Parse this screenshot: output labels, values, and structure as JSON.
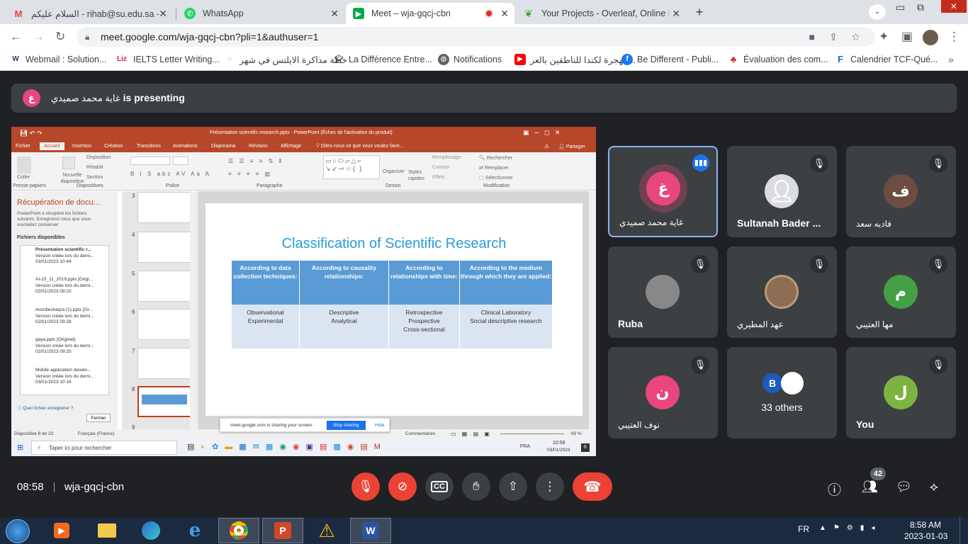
{
  "browser": {
    "tabs": [
      {
        "title": "السلام عليكم - rihab@su.edu.sa - جامعة",
        "icon": "gmail-icon"
      },
      {
        "title": "WhatsApp",
        "icon": "whatsapp-icon"
      },
      {
        "title": "Meet – wja-gqcj-cbn",
        "icon": "meet-icon",
        "active": true
      },
      {
        "title": "Your Projects - Overleaf, Online L",
        "icon": "overleaf-icon"
      }
    ],
    "url": "meet.google.com/wja-gqcj-cbn?pli=1&authuser=1",
    "bookmarks": [
      {
        "label": "Webmail : Solution...",
        "icon": "webmail-icon"
      },
      {
        "label": "IELTS Letter Writing...",
        "icon": "liz-icon",
        "badge": "Liz"
      },
      {
        "label": "خطة مذاكرة الايلتس في شهر",
        "icon": "loading-icon"
      },
      {
        "label": "La Différence Entre...",
        "icon": "graduation-icon"
      },
      {
        "label": "Notifications",
        "icon": "globe-icon"
      },
      {
        "label": "الهجرة لكندا للناطقين بالعر...",
        "icon": "youtube-icon"
      },
      {
        "label": "Be Different - Publi...",
        "icon": "facebook-icon"
      },
      {
        "label": "Évaluation des com...",
        "icon": "maple-icon"
      },
      {
        "label": "Calendrier TCF-Qué...",
        "icon": "f-icon"
      }
    ]
  },
  "meet": {
    "presenter_initial": "غ",
    "presenter_name": "غاية محمد صميدي",
    "presenting_suffix": "is presenting",
    "time": "08:58",
    "meeting_code": "wja-gqcj-cbn",
    "participant_count": "42",
    "participants": [
      {
        "name": "غاية محمد صميدي",
        "initial": "غ",
        "color": "#e8467c",
        "speaking": true
      },
      {
        "name": "Sultanah Bader ...",
        "photo": "default",
        "muted": true
      },
      {
        "name": "فاديه سعد",
        "initial": "ف",
        "color": "#6d4c41",
        "muted": true
      },
      {
        "name": "Ruba",
        "photo": "grey",
        "muted": true
      },
      {
        "name": "عهد المطيري",
        "photo": "room",
        "muted": true
      },
      {
        "name": "مها العتيبي",
        "initial": "م",
        "color": "#43a047",
        "muted": true
      },
      {
        "name": "نوف العتيبي",
        "initial": "ن",
        "color": "#e8467c",
        "muted": true
      },
      {
        "name": "33 others",
        "others_initial": "B"
      },
      {
        "name": "You",
        "initial": "ل",
        "color": "#7cb342",
        "muted": true
      }
    ]
  },
  "ppt": {
    "window_title": "Présentation scientific research.pptx - PowerPoint (Échec de l'activation du produit)",
    "menu": [
      "Fichier",
      "Accueil",
      "Insertion",
      "Création",
      "Transitions",
      "Animations",
      "Diaporama",
      "Révision",
      "Affichage",
      "Dites-nous ce que vous voulez faire..."
    ],
    "share": "Partager",
    "ribbon_groups": [
      "Presse-papiers",
      "Diapositives",
      "Police",
      "Paragraphe",
      "Dessin",
      "Modification"
    ],
    "ribbon": {
      "paste": "Coller",
      "new_slide": "Nouvelle diapositive",
      "layout": "Disposition",
      "reset": "Rétablir",
      "section": "Section",
      "arrange": "Organiser",
      "quick_styles": "Styles rapides",
      "fill": "Remplissage",
      "outline": "Contour",
      "effects": "Effets",
      "find": "Rechercher",
      "replace": "Remplacer",
      "select": "Sélectionner"
    },
    "recovery": {
      "title": "Récupération de docu...",
      "desc": "PowerPoint a récupéré les fichiers suivants. Enregistrez ceux que vous souhaitez conserver.",
      "available": "Fichiers disponibles",
      "files": [
        {
          "name": "Présentation scientific r...",
          "version": "Version créée lors du derni...",
          "date": "03/01/2023 10:44"
        },
        {
          "name": "AI-10_11_2019.pptx  [Origi...",
          "version": "Version créée lors du derni...",
          "date": "02/01/2023 09:20"
        },
        {
          "name": "moodleshaqra (1).pptx  [Or...",
          "version": "Version créée lors du derni...",
          "date": "02/01/2023 09:28"
        },
        {
          "name": "gaya.pptx  [Original]",
          "version": "Version créée lors du derni...",
          "date": "02/01/2023 09:20"
        },
        {
          "name": "Mobile application develo...",
          "version": "Version créée lors du derni...",
          "date": "03/01/2023 10:16"
        }
      ],
      "which": "Quel fichier enregistrer ?",
      "close": "Fermer"
    },
    "thumb_numbers": [
      "3",
      "4",
      "5",
      "6",
      "7",
      "8",
      "9"
    ],
    "slide": {
      "title": "Classification of Scientific Research",
      "columns": [
        {
          "head": "According to data collection techniques:",
          "body": "Observational\nExperimental"
        },
        {
          "head": "According to causality relationships:",
          "body": "Descriptive\nAnalytical"
        },
        {
          "head": "According to relationships with time:",
          "body": "Retrospective\nProspective\nCross-sectional"
        },
        {
          "head": "According to the medium through which they are applied:",
          "body": "Clinical Laboratory\nSocial descriptive research"
        }
      ]
    },
    "status_left": "Diapositive 8 de 22",
    "status_lang": "Français (France)",
    "status_comments": "Commentaires",
    "zoom": "69 %",
    "share_bar_text": "meet.google.com is sharing your screen.",
    "stop_sharing": "Stop sharing",
    "hide": "Hide",
    "inner_search": "Taper ici pour rechercher",
    "inner_lang": "FRA",
    "inner_time": "10:58",
    "inner_date": "03/01/2023",
    "inner_notif": "6"
  },
  "taskbar": {
    "lang": "FR",
    "time": "8:58 AM",
    "date": "2023-01-03"
  }
}
